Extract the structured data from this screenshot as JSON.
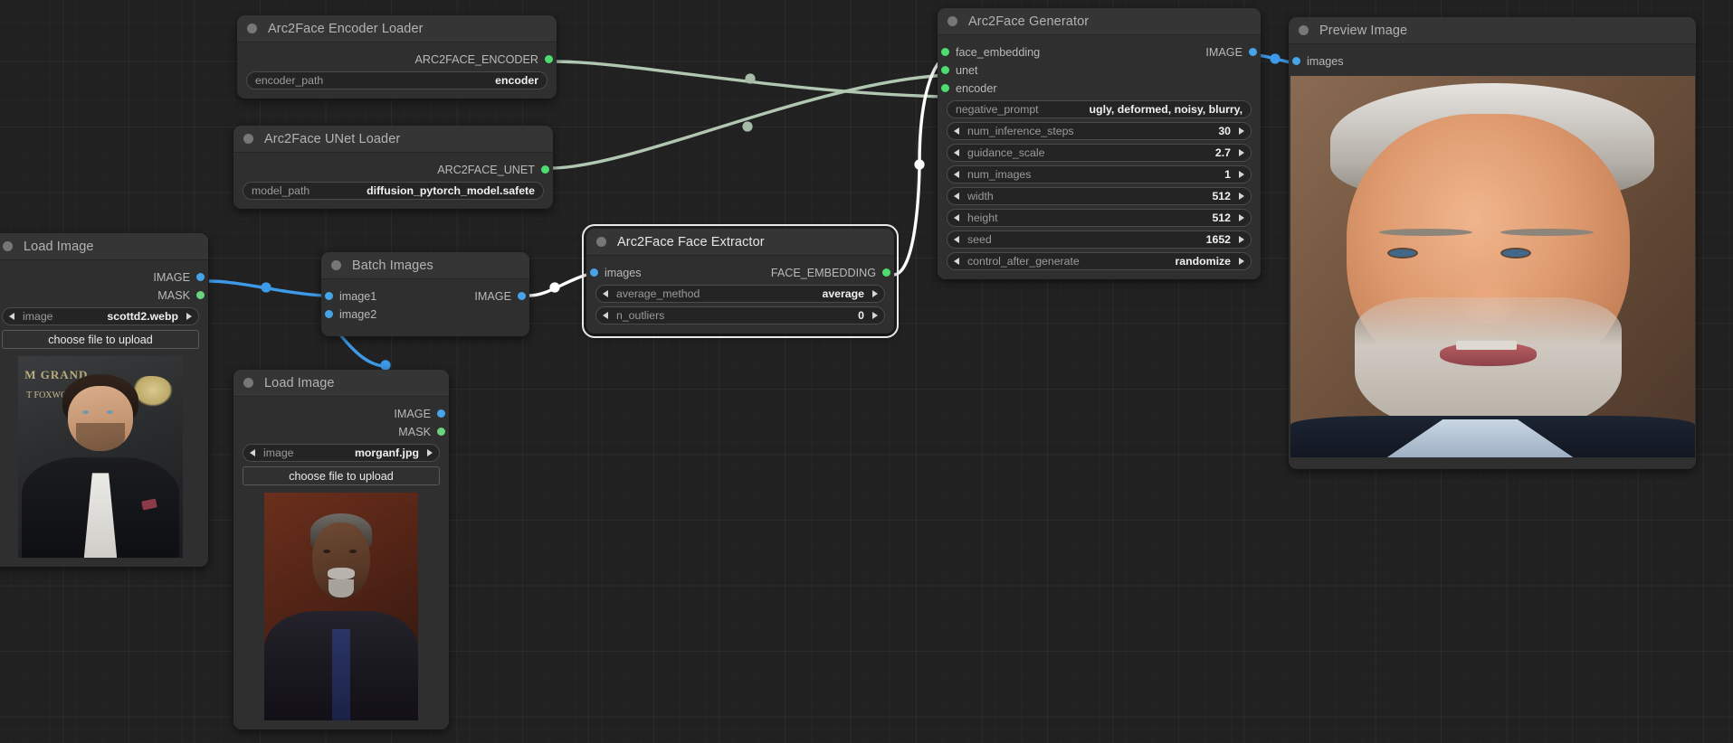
{
  "app": {
    "canvas_background": "#212121",
    "grid": true
  },
  "colors": {
    "node_body": "#2f2f2f",
    "node_header": "#353535",
    "slot_image": "#45a5e8",
    "slot_mask": "#6ad47f",
    "slot_model": "#4ddd6e",
    "link_image": "#3d9ae8",
    "link_model": "#b0c8b0",
    "link_selected": "#ffffff",
    "selection_outline": "#e8e8e8"
  },
  "nodes": [
    {
      "id": "arc2face-encoder-loader",
      "title": "Arc2Face Encoder Loader",
      "selected": false,
      "outputs": [
        {
          "label": "ARC2FACE_ENCODER",
          "type": "model"
        }
      ],
      "inputs": [],
      "widgets": [
        {
          "kind": "text",
          "name": "encoder_path",
          "value": "encoder"
        }
      ]
    },
    {
      "id": "arc2face-unet-loader",
      "title": "Arc2Face UNet Loader",
      "selected": false,
      "outputs": [
        {
          "label": "ARC2FACE_UNET",
          "type": "model"
        }
      ],
      "inputs": [],
      "widgets": [
        {
          "kind": "text",
          "name": "model_path",
          "value": "diffusion_pytorch_model.safete"
        }
      ]
    },
    {
      "id": "load-image-scott",
      "title": "Load Image",
      "selected": false,
      "outputs": [
        {
          "label": "IMAGE",
          "type": "image"
        },
        {
          "label": "MASK",
          "type": "mask"
        }
      ],
      "inputs": [],
      "widgets": [
        {
          "kind": "combo",
          "name": "image",
          "value": "scottd2.webp"
        },
        {
          "kind": "button",
          "label": "choose file to upload"
        }
      ],
      "preview": "scott-portrait"
    },
    {
      "id": "load-image-morgan",
      "title": "Load Image",
      "selected": false,
      "outputs": [
        {
          "label": "IMAGE",
          "type": "image"
        },
        {
          "label": "MASK",
          "type": "mask"
        }
      ],
      "inputs": [],
      "widgets": [
        {
          "kind": "combo",
          "name": "image",
          "value": "morganf.jpg"
        },
        {
          "kind": "button",
          "label": "choose file to upload"
        }
      ],
      "preview": "morgan-portrait"
    },
    {
      "id": "batch-images",
      "title": "Batch Images",
      "selected": false,
      "inputs": [
        {
          "label": "image1",
          "type": "image"
        },
        {
          "label": "image2",
          "type": "image"
        }
      ],
      "outputs": [
        {
          "label": "IMAGE",
          "type": "image"
        }
      ],
      "widgets": []
    },
    {
      "id": "arc2face-face-extractor",
      "title": "Arc2Face Face Extractor",
      "selected": true,
      "inputs": [
        {
          "label": "images",
          "type": "image"
        }
      ],
      "outputs": [
        {
          "label": "FACE_EMBEDDING",
          "type": "model"
        }
      ],
      "widgets": [
        {
          "kind": "combo",
          "name": "average_method",
          "value": "average"
        },
        {
          "kind": "combo",
          "name": "n_outliers",
          "value": "0"
        }
      ]
    },
    {
      "id": "arc2face-generator",
      "title": "Arc2Face Generator",
      "selected": false,
      "inputs": [
        {
          "label": "face_embedding",
          "type": "model"
        },
        {
          "label": "unet",
          "type": "model"
        },
        {
          "label": "encoder",
          "type": "model"
        }
      ],
      "outputs": [
        {
          "label": "IMAGE",
          "type": "image"
        }
      ],
      "widgets": [
        {
          "kind": "text",
          "name": "negative_prompt",
          "value": "ugly, deformed, noisy, blurry,"
        },
        {
          "kind": "combo",
          "name": "num_inference_steps",
          "value": "30"
        },
        {
          "kind": "combo",
          "name": "guidance_scale",
          "value": "2.7"
        },
        {
          "kind": "combo",
          "name": "num_images",
          "value": "1"
        },
        {
          "kind": "combo",
          "name": "width",
          "value": "512"
        },
        {
          "kind": "combo",
          "name": "height",
          "value": "512"
        },
        {
          "kind": "combo",
          "name": "seed",
          "value": "1652"
        },
        {
          "kind": "combo",
          "name": "control_after_generate",
          "value": "randomize"
        }
      ]
    },
    {
      "id": "preview-image",
      "title": "Preview Image",
      "selected": false,
      "inputs": [
        {
          "label": "images",
          "type": "image"
        }
      ],
      "outputs": [],
      "widgets": [],
      "preview": "generated-portrait"
    }
  ],
  "links": [
    {
      "from": "arc2face-encoder-loader.ARC2FACE_ENCODER",
      "to": "arc2face-generator.encoder",
      "type": "model"
    },
    {
      "from": "arc2face-unet-loader.ARC2FACE_UNET",
      "to": "arc2face-generator.unet",
      "type": "model"
    },
    {
      "from": "load-image-scott.IMAGE",
      "to": "batch-images.image1",
      "type": "image"
    },
    {
      "from": "load-image-morgan.IMAGE",
      "to": "batch-images.image2",
      "type": "image"
    },
    {
      "from": "batch-images.IMAGE",
      "to": "arc2face-face-extractor.images",
      "type": "selected"
    },
    {
      "from": "arc2face-face-extractor.FACE_EMBEDDING",
      "to": "arc2face-generator.face_embedding",
      "type": "selected"
    },
    {
      "from": "arc2face-generator.IMAGE",
      "to": "preview-image.images",
      "type": "image"
    }
  ]
}
